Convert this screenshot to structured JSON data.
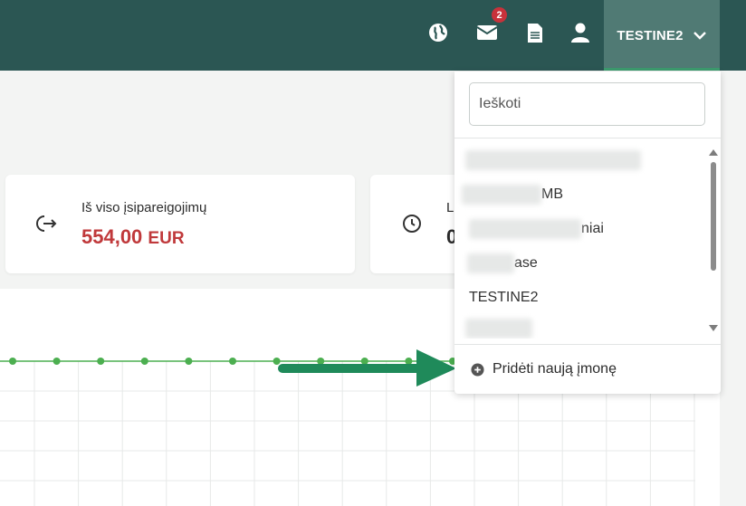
{
  "header": {
    "notifications_count": "2",
    "user_label": "TESTINE2",
    "icons": [
      "globe-icon",
      "mail-icon",
      "document-icon",
      "user-icon",
      "chevron-down-icon"
    ]
  },
  "cards": [
    {
      "label": "Iš viso įsipareigojimų",
      "value": "554,00",
      "currency": "EUR",
      "icon": "sign-out-arrow-icon"
    },
    {
      "label": "L",
      "value": "0",
      "icon": "clock-icon"
    }
  ],
  "company_dropdown": {
    "search_placeholder": "Ieškoti",
    "items": [
      {
        "visible_text": "",
        "blurred": true
      },
      {
        "visible_text": "MB",
        "blurred": true
      },
      {
        "visible_text": "niai",
        "blurred": true
      },
      {
        "visible_text": "ase",
        "blurred": true
      },
      {
        "visible_text": "TESTINE2",
        "blurred": false
      },
      {
        "visible_text": "",
        "blurred": true
      }
    ],
    "add_label": "Pridėti naują įmonę",
    "add_icon": "plus-circle-icon"
  },
  "colors": {
    "header_bg": "#2b5653",
    "user_menu_bg": "#507a74",
    "accent_green": "#3c9b6e",
    "value_red": "#c0393b",
    "badge_red": "#c8323b",
    "chart_line": "#4caf50",
    "annotation_arrow": "#1f8a5a"
  },
  "chart_data": {
    "type": "line",
    "series": [
      {
        "values": [
          0,
          0,
          0,
          0,
          0,
          0,
          0,
          0,
          0,
          0,
          0
        ]
      }
    ]
  }
}
